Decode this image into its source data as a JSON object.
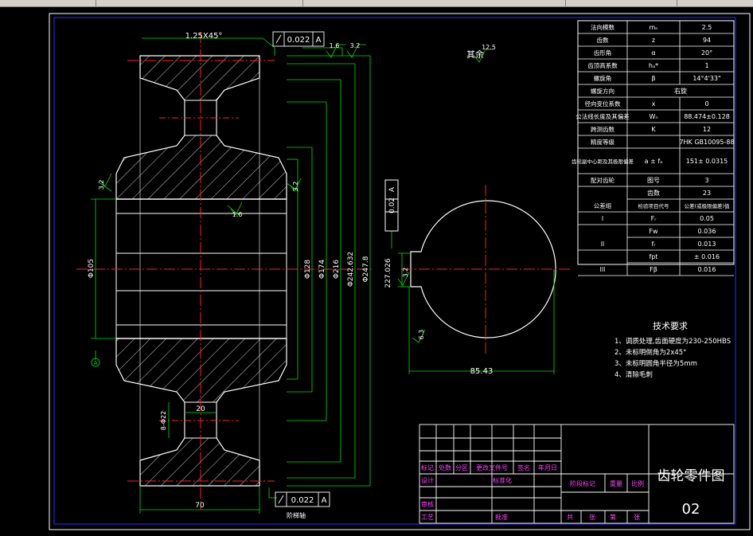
{
  "dims": {
    "chamfer": "1.25X45°",
    "runout_top": "0.022",
    "runout_top_datum": "A",
    "rough_top_a": "1.6",
    "rough_top_b": "3.2",
    "rough_left": "3.2",
    "rough_right": "3.2",
    "rough_bore": "1.6",
    "dia_bore": "Φ105",
    "dia_128": "Φ128",
    "dia_174": "Φ174",
    "dia_216": "Φ216",
    "dia_242": "Φ242.632",
    "dia_247": "Φ247.8",
    "web_thickness": "20",
    "web_hole": "8-Φ22",
    "face_width": "70",
    "runout_bottom": "0.022",
    "runout_bottom_datum": "A",
    "datum_label": "A",
    "section_caption": "阶梯轴",
    "rest_label": "其余",
    "rest_rough": "12.5",
    "keyway_tol": "0.02",
    "keyway_tol_datum": "A",
    "keyway_depth": "227.026",
    "keyway_rough": "3.2",
    "side_rough": "6.3",
    "width_85": "85.43"
  },
  "params": [
    {
      "name": "法向模数",
      "sym": "mₙ",
      "val": "2.5"
    },
    {
      "name": "齿数",
      "sym": "z",
      "val": "94"
    },
    {
      "name": "齿形角",
      "sym": "α",
      "val": "20°"
    },
    {
      "name": "齿顶高系数",
      "sym": "hₐ*",
      "val": "1"
    },
    {
      "name": "螺旋角",
      "sym": "β",
      "val": "14°4'33\""
    },
    {
      "name": "螺旋方向",
      "sym": "",
      "val": "右旋"
    },
    {
      "name": "径向变位系数",
      "sym": "x",
      "val": "0"
    },
    {
      "name": "公法线长度及其偏差",
      "sym": "Wₙ",
      "val": "88.474±0.128"
    },
    {
      "name": "跨测齿数",
      "sym": "K",
      "val": "12"
    },
    {
      "name": "精度等级",
      "sym": "",
      "val": "7HK GB10095-88"
    },
    {
      "name": "齿轮副中心距及其极限偏差",
      "sym": "a ± fₐ",
      "val": "151± 0.0315"
    },
    {
      "name": "配对齿轮",
      "sym": "图号",
      "val": "3"
    },
    {
      "name": "",
      "sym": "齿数",
      "val": "23"
    },
    {
      "name": "公差组",
      "sym": "检验项目代号",
      "val": "公差(或极限偏差)值"
    },
    {
      "name": "I",
      "sym": "Fᵣ",
      "val": "0.05"
    },
    {
      "name": "",
      "sym": "Fw",
      "val": "0.036"
    },
    {
      "name": "II",
      "sym": "fᵣ",
      "val": "0.013"
    },
    {
      "name": "",
      "sym": "fpt",
      "val": "± 0.016"
    },
    {
      "name": "III",
      "sym": "Fβ",
      "val": "0.016"
    }
  ],
  "tech": {
    "title": "技术要求",
    "items": [
      "1、调质处理,齿面硬度为230-250HBS",
      "2、未标明倒角为2x45°",
      "3、未标明圆角半径为5mm",
      "4、清除毛刺"
    ]
  },
  "title_block": {
    "h_biaoji": "标记",
    "h_chushu": "处数",
    "h_fenqu": "分区",
    "h_wenjian": "更改文件号",
    "h_qianming": "签名",
    "h_date": "年月日",
    "sheji": "设计",
    "biaozhunhua": "标准化",
    "jieduan": "阶段标记",
    "zhongliang": "重量",
    "bili": "比例",
    "shenhe": "审核",
    "gongyi": "工艺",
    "pizhun": "批准",
    "gong": "共",
    "zhang": "张",
    "di": "第",
    "zhang2": "张",
    "name": "齿轮零件图",
    "number": "02"
  }
}
